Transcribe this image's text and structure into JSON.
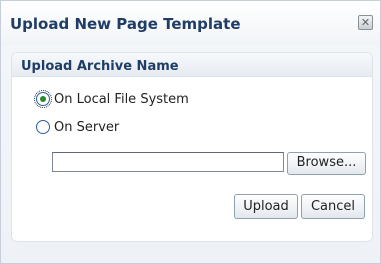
{
  "dialog": {
    "title": "Upload New Page Template",
    "close_icon": "close-icon",
    "close_glyph": "✕"
  },
  "section": {
    "title": "Upload Archive Name"
  },
  "source_options": [
    {
      "label": "On Local File System",
      "selected": true
    },
    {
      "label": "On Server",
      "selected": false
    }
  ],
  "file_input": {
    "value": "",
    "placeholder": ""
  },
  "buttons": {
    "browse": "Browse...",
    "upload": "Upload",
    "cancel": "Cancel"
  },
  "colors": {
    "title": "#1f3d66",
    "radio_selected_dot": "#2b8a2b"
  }
}
